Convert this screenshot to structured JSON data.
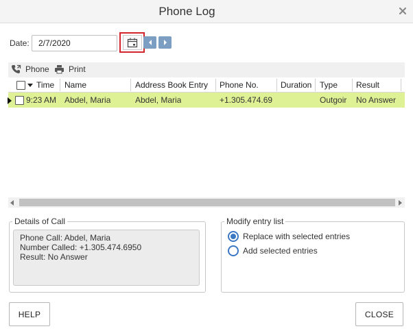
{
  "window": {
    "title": "Phone Log",
    "close_icon": "close-icon"
  },
  "date": {
    "label": "Date:",
    "value": "2/7/2020"
  },
  "toolbar": {
    "phone_label": "Phone",
    "print_label": "Print"
  },
  "table": {
    "columns": [
      "Time",
      "Name",
      "Address Book Entry",
      "Phone No.",
      "Duration",
      "Type",
      "Result"
    ],
    "rows": [
      {
        "time": "9:23 AM",
        "name": "Abdel, Maria",
        "address_book_entry": "Abdel, Maria",
        "phone": "+1.305.474.69",
        "duration": "",
        "type": "Outgoir",
        "result": "No Answer"
      }
    ],
    "selected_row_color": "#def295"
  },
  "details": {
    "legend": "Details of Call",
    "line1": "Phone Call: Abdel, Maria",
    "line2": "Number Called: +1.305.474.6950",
    "line3": "Result: No Answer"
  },
  "modify": {
    "legend": "Modify entry list",
    "options": [
      {
        "label": "Replace with selected entries",
        "selected": true
      },
      {
        "label": "Add selected entries",
        "selected": false
      }
    ]
  },
  "buttons": {
    "help": "HELP",
    "close": "CLOSE"
  },
  "colors": {
    "accent": "#3b78c4",
    "highlight": "#d2242a",
    "nav_button": "#7b9ec2"
  }
}
